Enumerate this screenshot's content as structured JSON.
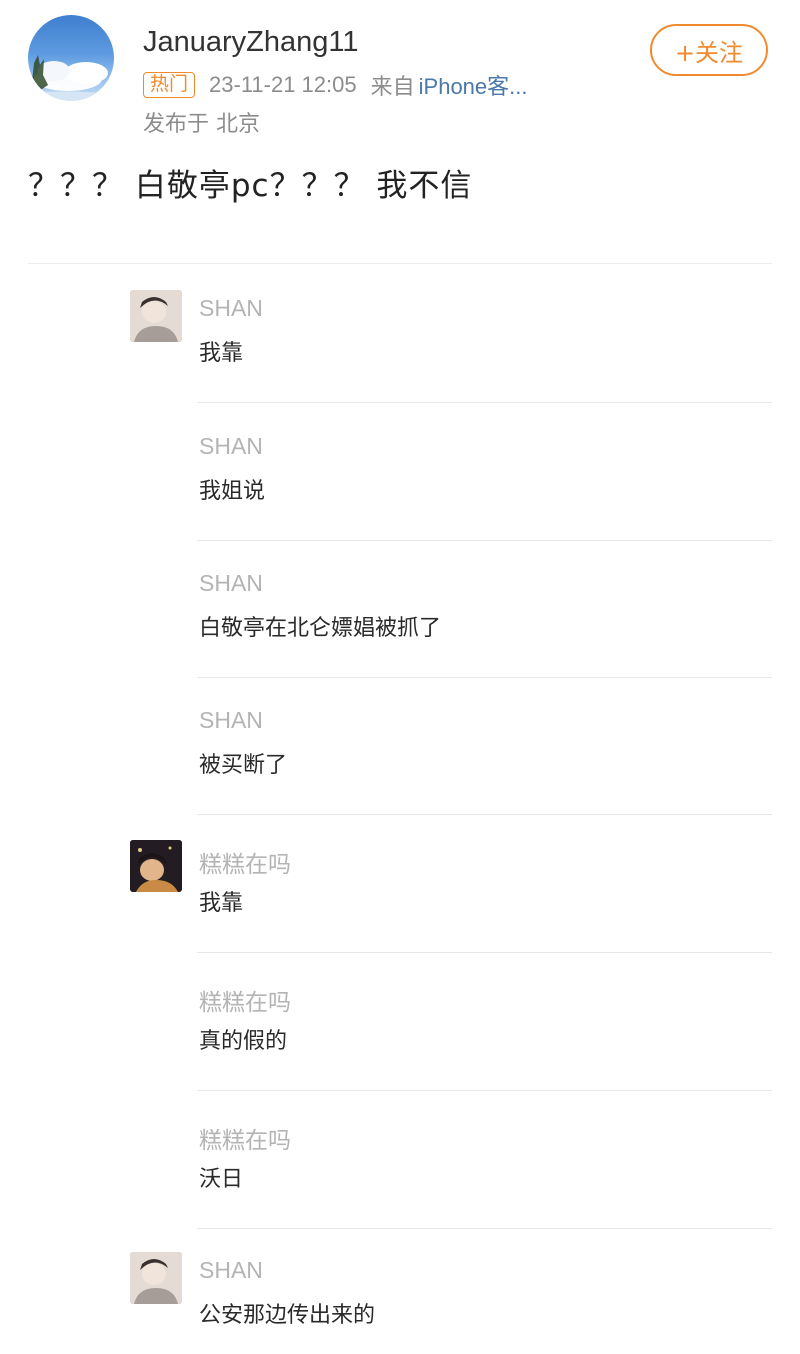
{
  "post": {
    "username": "JanuaryZhang11",
    "hot_badge": "热门",
    "timestamp": "23-11-21 12:05",
    "source_prefix": "来自",
    "source_name": "iPhone客...",
    "location": "发布于 北京",
    "follow_label": "+关注",
    "text": "？？？ 白敬亭pc？？？ 我不信"
  },
  "comments": [
    {
      "name": "SHAN",
      "text": "我靠"
    },
    {
      "name": "SHAN",
      "text": "我姐说"
    },
    {
      "name": "SHAN",
      "text": "白敬亭在北仑嫖娼被抓了"
    },
    {
      "name": "SHAN",
      "text": "被买断了"
    },
    {
      "name": "糕糕在吗",
      "text": "我靠"
    },
    {
      "name": "糕糕在吗",
      "text": "真的假的"
    },
    {
      "name": "糕糕在吗",
      "text": "沃日"
    },
    {
      "name": "SHAN",
      "text": "公安那边传出来的"
    }
  ],
  "colors": {
    "accent_orange": "#f08a2f",
    "link_blue": "#4a78a8",
    "meta_gray": "#8c8c8c"
  }
}
